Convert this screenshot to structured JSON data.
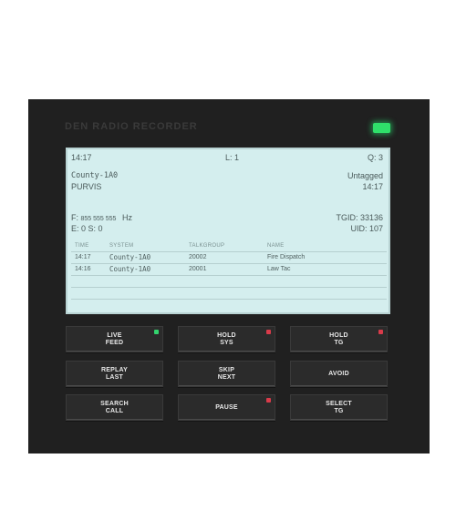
{
  "device": {
    "title": "DEN RADIO RECORDER",
    "status_led_color": "#2fe06a"
  },
  "screen": {
    "time": "14:17",
    "l_value": "L: 1",
    "q_value": "Q: 3",
    "system": "County-1A0",
    "site": "PURVIS",
    "tag": "Untagged",
    "tag_time": "14:17",
    "freq_prefix": "F:",
    "freq_value": "855 555 555",
    "freq_unit": "Hz",
    "es": "E: 0 S: 0",
    "tgid": "TGID: 33136",
    "uid": "UID: 107",
    "table": {
      "headers": [
        "TIME",
        "SYSTEM",
        "TALKGROUP",
        "NAME"
      ],
      "rows": [
        [
          "14:17",
          "County-1A0",
          "20002",
          "Fire Dispatch"
        ],
        [
          "14:16",
          "County-1A0",
          "20001",
          "Law Tac"
        ]
      ]
    }
  },
  "buttons": [
    {
      "line1": "LIVE",
      "line2": "FEED",
      "indicator": "green"
    },
    {
      "line1": "HOLD",
      "line2": "SYS",
      "indicator": "red"
    },
    {
      "line1": "HOLD",
      "line2": "TG",
      "indicator": "red"
    },
    {
      "line1": "REPLAY",
      "line2": "LAST",
      "indicator": ""
    },
    {
      "line1": "SKIP",
      "line2": "NEXT",
      "indicator": ""
    },
    {
      "line1": "AVOID",
      "line2": "",
      "indicator": ""
    },
    {
      "line1": "SEARCH",
      "line2": "CALL",
      "indicator": ""
    },
    {
      "line1": "PAUSE",
      "line2": "",
      "indicator": "red"
    },
    {
      "line1": "SELECT",
      "line2": "TG",
      "indicator": ""
    }
  ]
}
